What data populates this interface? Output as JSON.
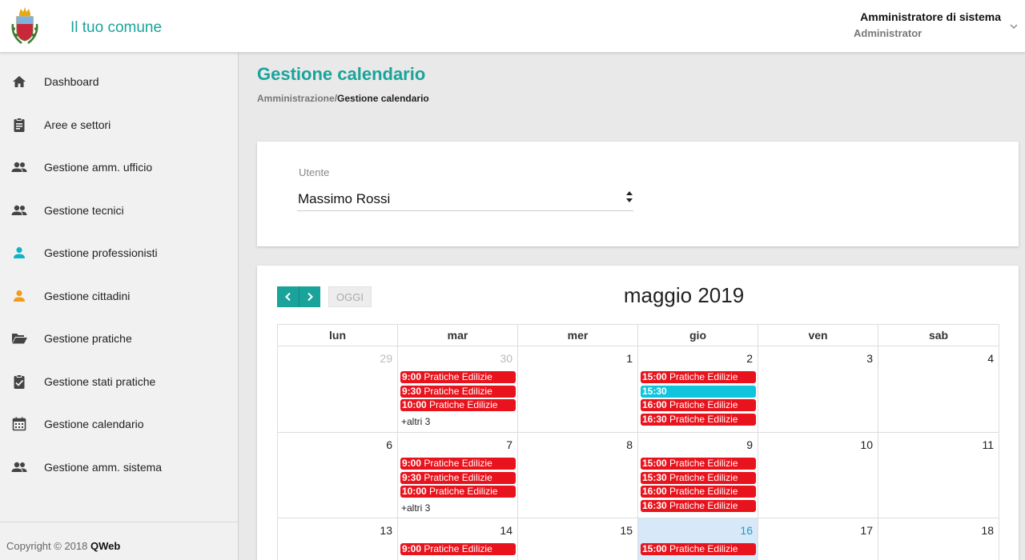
{
  "header": {
    "app_title": "Il tuo comune",
    "user_name": "Amministratore di sistema",
    "user_role": "Administrator"
  },
  "sidebar": {
    "items": [
      {
        "label": "Dashboard",
        "icon": "home-icon",
        "color": "#444444"
      },
      {
        "label": "Aree e settori",
        "icon": "clipboard-icon",
        "color": "#444444"
      },
      {
        "label": "Gestione amm. ufficio",
        "icon": "people-icon",
        "color": "#444444"
      },
      {
        "label": "Gestione tecnici",
        "icon": "people-icon",
        "color": "#444444"
      },
      {
        "label": "Gestione professionisti",
        "icon": "person-icon",
        "color": "#10b3c8"
      },
      {
        "label": "Gestione cittadini",
        "icon": "person-icon",
        "color": "#f29a1b"
      },
      {
        "label": "Gestione pratiche",
        "icon": "folder-open-icon",
        "color": "#444444"
      },
      {
        "label": "Gestione stati pratiche",
        "icon": "clipboard-check-icon",
        "color": "#444444"
      },
      {
        "label": "Gestione calendario",
        "icon": "calendar-icon",
        "color": "#444444"
      },
      {
        "label": "Gestione amm. sistema",
        "icon": "people-icon",
        "color": "#444444"
      }
    ],
    "footer": {
      "copyright": "Copyright © 2018 ",
      "brand": "QWeb"
    }
  },
  "page": {
    "title": "Gestione calendario",
    "breadcrumb_parent": "Amministrazione",
    "breadcrumb_sep": "/",
    "breadcrumb_current": "Gestione calendario"
  },
  "user_filter": {
    "label": "Utente",
    "value": "Massimo Rossi"
  },
  "calendar": {
    "today_label": "OGGI",
    "title": "maggio 2019",
    "weekdays": [
      "lun",
      "mar",
      "mer",
      "gio",
      "ven",
      "sab"
    ],
    "weeks": [
      {
        "days": [
          {
            "num": "29",
            "other": true,
            "events": [],
            "more": ""
          },
          {
            "num": "30",
            "other": true,
            "events": [
              {
                "time": "9:00",
                "title": "Pratiche Edilizie",
                "color": "red"
              },
              {
                "time": "9:30",
                "title": "Pratiche Edilizie",
                "color": "red"
              },
              {
                "time": "10:00",
                "title": "Pratiche Edilizie",
                "color": "red"
              }
            ],
            "more": "+altri 3"
          },
          {
            "num": "1",
            "other": false,
            "events": [],
            "more": ""
          },
          {
            "num": "2",
            "other": false,
            "events": [
              {
                "time": "15:00",
                "title": "Pratiche Edilizie",
                "color": "red"
              },
              {
                "time": "15:30",
                "title": "",
                "color": "cyan"
              },
              {
                "time": "16:00",
                "title": "Pratiche Edilizie",
                "color": "red"
              },
              {
                "time": "16:30",
                "title": "Pratiche Edilizie",
                "color": "red"
              }
            ],
            "more": ""
          },
          {
            "num": "3",
            "other": false,
            "events": [],
            "more": ""
          },
          {
            "num": "4",
            "other": false,
            "events": [],
            "more": ""
          }
        ]
      },
      {
        "days": [
          {
            "num": "6",
            "other": false,
            "events": [],
            "more": ""
          },
          {
            "num": "7",
            "other": false,
            "events": [
              {
                "time": "9:00",
                "title": "Pratiche Edilizie",
                "color": "red"
              },
              {
                "time": "9:30",
                "title": "Pratiche Edilizie",
                "color": "red"
              },
              {
                "time": "10:00",
                "title": "Pratiche Edilizie",
                "color": "red"
              }
            ],
            "more": "+altri 3"
          },
          {
            "num": "8",
            "other": false,
            "events": [],
            "more": ""
          },
          {
            "num": "9",
            "other": false,
            "events": [
              {
                "time": "15:00",
                "title": "Pratiche Edilizie",
                "color": "red"
              },
              {
                "time": "15:30",
                "title": "Pratiche Edilizie",
                "color": "red"
              },
              {
                "time": "16:00",
                "title": "Pratiche Edilizie",
                "color": "red"
              },
              {
                "time": "16:30",
                "title": "Pratiche Edilizie",
                "color": "red"
              }
            ],
            "more": ""
          },
          {
            "num": "10",
            "other": false,
            "events": [],
            "more": ""
          },
          {
            "num": "11",
            "other": false,
            "events": [],
            "more": ""
          }
        ]
      },
      {
        "days": [
          {
            "num": "13",
            "other": false,
            "events": [],
            "more": ""
          },
          {
            "num": "14",
            "other": false,
            "events": [
              {
                "time": "9:00",
                "title": "Pratiche Edilizie",
                "color": "red"
              }
            ],
            "more": ""
          },
          {
            "num": "15",
            "other": false,
            "events": [],
            "more": ""
          },
          {
            "num": "16",
            "other": false,
            "today": true,
            "events": [
              {
                "time": "15:00",
                "title": "Pratiche Edilizie",
                "color": "red"
              }
            ],
            "more": ""
          },
          {
            "num": "17",
            "other": false,
            "events": [],
            "more": ""
          },
          {
            "num": "18",
            "other": false,
            "events": [],
            "more": ""
          }
        ]
      }
    ]
  },
  "colors": {
    "accent": "#1aa39a",
    "event_red": "#e8131c",
    "event_cyan": "#0fc4dc",
    "today_bg": "#d7e9f8"
  }
}
